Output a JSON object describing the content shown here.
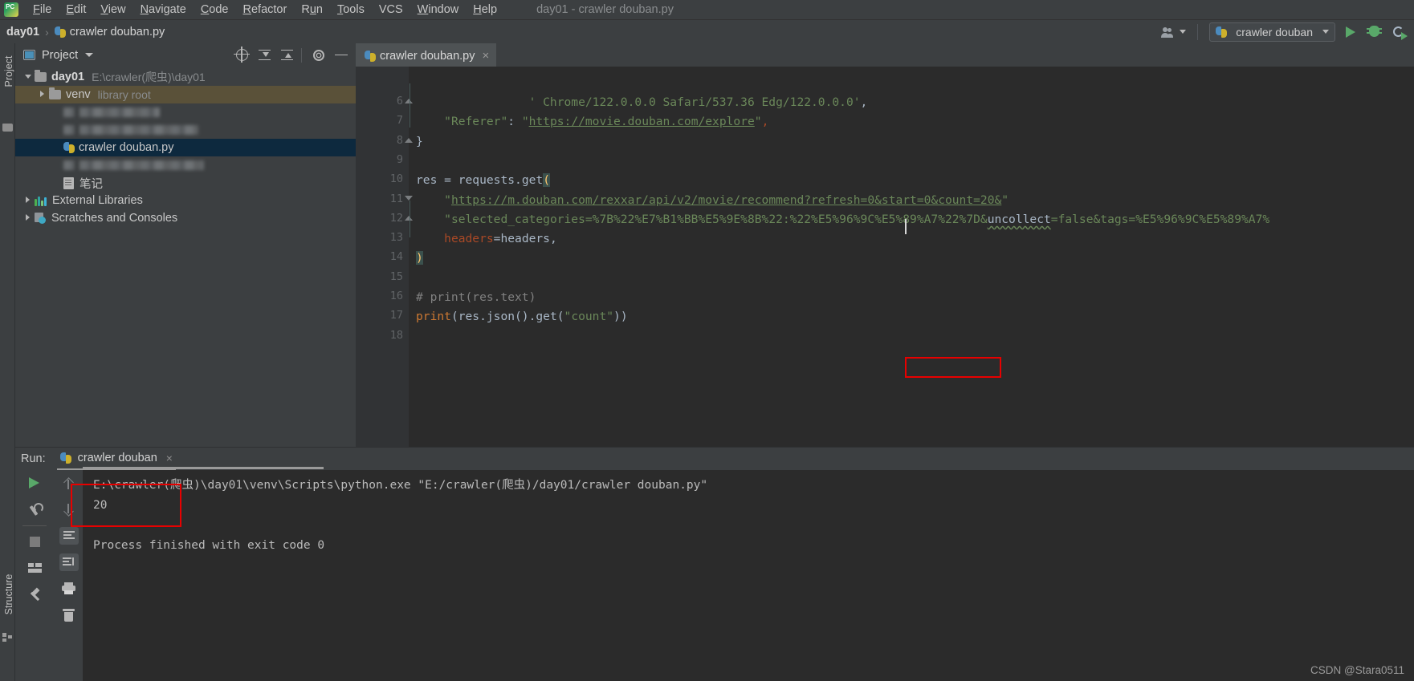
{
  "window": {
    "title": "day01 - crawler douban.py",
    "app_icon": "pycharm-logo-icon"
  },
  "menubar": {
    "items": [
      {
        "label": "File",
        "mnemonic": "F"
      },
      {
        "label": "Edit",
        "mnemonic": "E"
      },
      {
        "label": "View",
        "mnemonic": "V"
      },
      {
        "label": "Navigate",
        "mnemonic": "N"
      },
      {
        "label": "Code",
        "mnemonic": "C"
      },
      {
        "label": "Refactor",
        "mnemonic": "R"
      },
      {
        "label": "Run",
        "mnemonic": "u"
      },
      {
        "label": "Tools",
        "mnemonic": "T"
      },
      {
        "label": "VCS",
        "mnemonic": ""
      },
      {
        "label": "Window",
        "mnemonic": "W"
      },
      {
        "label": "Help",
        "mnemonic": "H"
      }
    ]
  },
  "breadcrumb": {
    "root": "day01",
    "separator": "›",
    "file": "crawler douban.py"
  },
  "toolbar_right": {
    "account_icon": "people-icon",
    "run_config": "crawler douban",
    "run_icon": "run-play-icon",
    "debug_icon": "debug-bug-icon",
    "rerun_icon": "rerun-icon"
  },
  "left_strip": {
    "project_label": "Project",
    "structure_label": "Structure"
  },
  "project_panel": {
    "title": "Project",
    "tools": [
      "locate-target-icon",
      "expand-all-icon",
      "collapse-all-icon",
      "settings-gear-icon",
      "hide-minus-icon"
    ],
    "tree": [
      {
        "id": "day01",
        "label": "day01",
        "info": "E:\\crawler(爬虫)\\day01",
        "indent": 0,
        "arrow": "open",
        "icon": "folder-icon",
        "bold": true,
        "state": "normal"
      },
      {
        "id": "venv",
        "label": "venv",
        "info": "library root",
        "indent": 1,
        "arrow": "closed",
        "icon": "folder-icon",
        "bold": false,
        "state": "highlighted"
      },
      {
        "id": "blurred-1",
        "label": "",
        "info": "",
        "indent": 2,
        "arrow": "none",
        "icon": "blurred-icon",
        "bold": false,
        "state": "blurred",
        "blur_width": 100
      },
      {
        "id": "blurred-2",
        "label": "",
        "info": "",
        "indent": 2,
        "arrow": "none",
        "icon": "blurred-icon",
        "bold": false,
        "state": "blurred",
        "blur_width": 148
      },
      {
        "id": "crawler-douban-py",
        "label": "crawler douban.py",
        "info": "",
        "indent": 2,
        "arrow": "none",
        "icon": "python-file-icon",
        "bold": false,
        "state": "selected"
      },
      {
        "id": "blurred-3",
        "label": "",
        "info": "",
        "indent": 2,
        "arrow": "none",
        "icon": "blurred-icon",
        "bold": false,
        "state": "blurred",
        "blur_width": 155
      },
      {
        "id": "biji",
        "label": "笔记",
        "info": "",
        "indent": 2,
        "arrow": "none",
        "icon": "note-file-icon",
        "bold": false,
        "state": "normal"
      },
      {
        "id": "external-libraries",
        "label": "External Libraries",
        "info": "",
        "indent": 0,
        "arrow": "closed",
        "icon": "libraries-icon",
        "bold": false,
        "state": "normal"
      },
      {
        "id": "scratches-consoles",
        "label": "Scratches and Consoles",
        "info": "",
        "indent": 0,
        "arrow": "closed",
        "icon": "scratches-icon",
        "bold": false,
        "state": "normal"
      }
    ]
  },
  "editor": {
    "tab": {
      "label": "crawler douban.py",
      "close": "×",
      "icon": "python-file-icon"
    },
    "first_visible_line": 6,
    "lines": [
      {
        "num": 6,
        "segments": [
          {
            "t": "                ' Chrome/122.0.0.0 Safari/537.36 Edg/122.0.0.0'",
            "c": "s-str"
          },
          {
            "t": ",",
            "c": "s-id"
          }
        ],
        "fold": "up"
      },
      {
        "num": 7,
        "segments": [
          {
            "t": "    ",
            "c": "s-id"
          },
          {
            "t": "\"Referer\"",
            "c": "s-str"
          },
          {
            "t": ": ",
            "c": "s-id"
          },
          {
            "t": "\"",
            "c": "s-str"
          },
          {
            "t": "https://movie.douban.com/explore",
            "c": "s-url"
          },
          {
            "t": "\"",
            "c": "s-str"
          },
          {
            "t": ",",
            "c": "s-named"
          }
        ],
        "fold": "none"
      },
      {
        "num": 8,
        "segments": [
          {
            "t": "}",
            "c": "s-id"
          }
        ],
        "fold": "up"
      },
      {
        "num": 9,
        "segments": [],
        "fold": "none"
      },
      {
        "num": 10,
        "segments": [
          {
            "t": "res ",
            "c": "s-id"
          },
          {
            "t": "= ",
            "c": "s-id"
          },
          {
            "t": "requests",
            "c": "s-id"
          },
          {
            "t": ".",
            "c": "s-id"
          },
          {
            "t": "get",
            "c": "s-id"
          },
          {
            "t": "(",
            "c": "s-bracehl"
          }
        ],
        "fold": "none"
      },
      {
        "num": 11,
        "segments": [
          {
            "t": "    ",
            "c": "s-id"
          },
          {
            "t": "\"",
            "c": "s-str"
          },
          {
            "t": "https://m.douban.com/rexxar/api/v2/movie/recommend?refresh=0&start=0&count=20&",
            "c": "s-url"
          },
          {
            "t": "\"",
            "c": "s-str"
          }
        ],
        "fold": "down"
      },
      {
        "num": 12,
        "segments": [
          {
            "t": "    ",
            "c": "s-id"
          },
          {
            "t": "\"selected_categories=%7B%22%E7%B1%BB%E5%9E%8B%22:%22%E5%96%9C%E5%89%A7%22%7D&",
            "c": "s-str"
          },
          {
            "t": "uncollect",
            "c": "s-wavy"
          },
          {
            "t": "=false&tags=%E5%96%9C%E5%89%A7%",
            "c": "s-str"
          }
        ],
        "fold": "up"
      },
      {
        "num": 13,
        "segments": [
          {
            "t": "    ",
            "c": "s-id"
          },
          {
            "t": "headers",
            "c": "s-named"
          },
          {
            "t": "=headers,",
            "c": "s-id"
          }
        ],
        "fold": "none"
      },
      {
        "num": 14,
        "segments": [
          {
            "t": ")",
            "c": "s-bracehl"
          }
        ],
        "fold": "none"
      },
      {
        "num": 15,
        "segments": [],
        "fold": "none"
      },
      {
        "num": 16,
        "segments": [
          {
            "t": "# print(res.text)",
            "c": "s-cmt"
          }
        ],
        "fold": "none"
      },
      {
        "num": 17,
        "segments": [
          {
            "t": "print",
            "c": "s-kw"
          },
          {
            "t": "(res.json().get(",
            "c": "s-id"
          },
          {
            "t": "\"count\"",
            "c": "s-str"
          },
          {
            "t": "))",
            "c": "s-id"
          }
        ],
        "fold": "none"
      },
      {
        "num": 18,
        "segments": [],
        "fold": "none"
      }
    ]
  },
  "run_panel": {
    "label": "Run:",
    "tab_label": "crawler douban",
    "tab_close": "×",
    "side_buttons": [
      "run-play-icon",
      "wrench-settings-icon",
      "stop-icon",
      "layout-icon",
      "pin-icon"
    ],
    "side_buttons2": [
      "scroll-up-icon",
      "scroll-down-icon",
      "soft-wrap-icon",
      "scroll-to-end-icon",
      "print-icon",
      "trash-icon"
    ],
    "console": [
      "E:\\crawler(爬虫)\\day01\\venv\\Scripts\\python.exe \"E:/crawler(爬虫)/day01/crawler douban.py\"",
      "20",
      "",
      "Process finished with exit code 0"
    ]
  },
  "annotations": {
    "highlight_color": "#e80000",
    "code_highlight_target": "t(\"count\"))",
    "output_highlight_target": "20"
  },
  "watermark": "CSDN @Stara0511"
}
